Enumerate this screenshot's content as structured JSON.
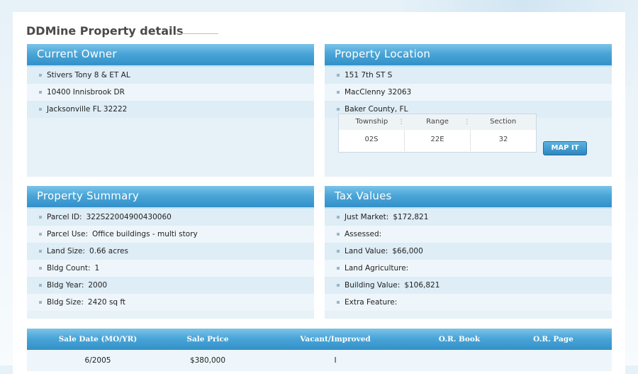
{
  "page_title": "DDMine Property details",
  "current_owner": {
    "heading": "Current Owner",
    "lines": [
      "Stivers Tony 8 & ET AL",
      "10400 Innisbrook DR",
      "Jacksonville FL 32222"
    ]
  },
  "property_location": {
    "heading": "Property Location",
    "lines": [
      "151 7th ST S",
      "MacClenny 32063",
      "Baker County, FL"
    ],
    "trs": {
      "headers": [
        "Township",
        "Range",
        "Section"
      ],
      "values": [
        "02S",
        "22E",
        "32"
      ]
    },
    "map_button": "MAP IT"
  },
  "property_summary": {
    "heading": "Property Summary",
    "rows": [
      {
        "label": "Parcel ID:",
        "value": "322S22004900430060"
      },
      {
        "label": "Parcel Use:",
        "value": "Office buildings - multi story"
      },
      {
        "label": "Land Size:",
        "value": "0.66 acres"
      },
      {
        "label": "Bldg Count:",
        "value": "1"
      },
      {
        "label": "Bldg Year:",
        "value": "2000"
      },
      {
        "label": "Bldg Size:",
        "value": "2420 sq ft"
      }
    ]
  },
  "tax_values": {
    "heading": "Tax Values",
    "rows": [
      {
        "label": "Just Market:",
        "value": "$172,821"
      },
      {
        "label": "Assessed:",
        "value": ""
      },
      {
        "label": "Land Value:",
        "value": "$66,000"
      },
      {
        "label": "Land Agriculture:",
        "value": ""
      },
      {
        "label": "Building Value:",
        "value": "$106,821"
      },
      {
        "label": "Extra Feature:",
        "value": ""
      }
    ]
  },
  "sales": {
    "headers": [
      "Sale Date (MO/YR)",
      "Sale Price",
      "Vacant/Improved",
      "O.R. Book",
      "O.R. Page"
    ],
    "rows": [
      [
        "6/2005",
        "$380,000",
        "I",
        "",
        ""
      ]
    ]
  }
}
